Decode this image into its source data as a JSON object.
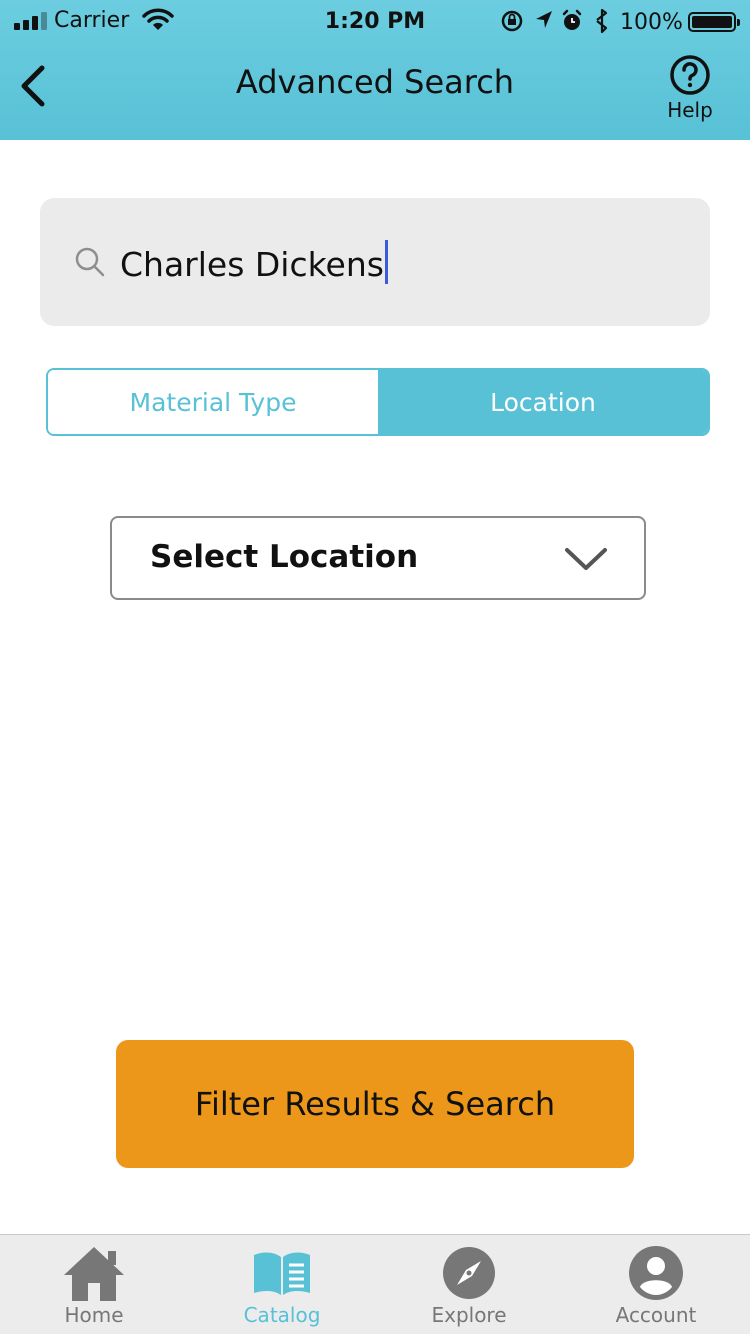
{
  "status_bar": {
    "carrier": "Carrier",
    "time": "1:20 PM",
    "battery_percent": "100%"
  },
  "nav": {
    "title": "Advanced Search",
    "help_label": "Help",
    "back_icon": "chevron-left-icon",
    "help_icon": "question-circle-icon"
  },
  "search": {
    "value": "Charles Dickens",
    "icon": "search-icon"
  },
  "segmented": {
    "tabs": [
      {
        "label": "Material Type",
        "selected": false
      },
      {
        "label": "Location",
        "selected": true
      }
    ]
  },
  "dropdown": {
    "label": "Select Location",
    "icon": "chevron-down-icon"
  },
  "primary_button": {
    "label": "Filter Results & Search"
  },
  "tabbar": {
    "items": [
      {
        "label": "Home",
        "icon": "home-icon",
        "active": false
      },
      {
        "label": "Catalog",
        "icon": "book-icon",
        "active": true
      },
      {
        "label": "Explore",
        "icon": "compass-icon",
        "active": false
      },
      {
        "label": "Account",
        "icon": "user-icon",
        "active": false
      }
    ]
  },
  "colors": {
    "header": "#58c1d6",
    "accent": "#58c1d6",
    "primary_button": "#ec9719",
    "tab_inactive": "#777777",
    "search_bg": "#ebebeb",
    "caret": "#3b5bdb"
  }
}
